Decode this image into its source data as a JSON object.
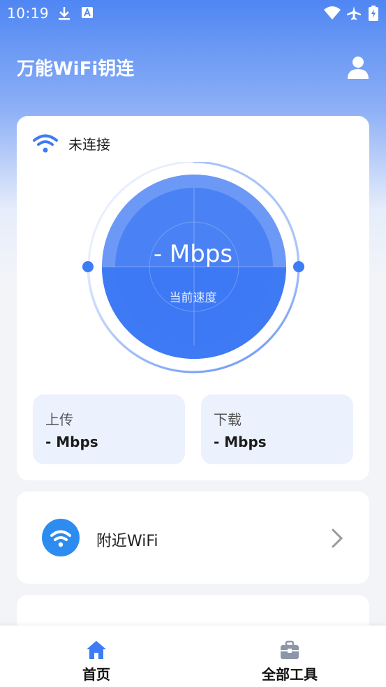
{
  "status_bar": {
    "time": "10:19",
    "icons": [
      "download-icon",
      "store-icon",
      "wifi-signal-icon",
      "airplane-mode-icon",
      "battery-charging-icon"
    ]
  },
  "header": {
    "title": "万能WiFi钥连",
    "user_icon": "user-icon"
  },
  "speed_card": {
    "connection_status": "未连接",
    "speed_value": "- Mbps",
    "speed_caption": "当前速度",
    "upload": {
      "label": "上传",
      "value": "- Mbps"
    },
    "download": {
      "label": "下载",
      "value": "- Mbps"
    }
  },
  "nearby_wifi": {
    "label": "附近WiFi",
    "icon": "wifi-icon"
  },
  "bottom_nav": {
    "items": [
      {
        "label": "首页",
        "icon": "home-icon",
        "active": true
      },
      {
        "label": "全部工具",
        "icon": "toolbox-icon",
        "active": false
      }
    ]
  },
  "colors": {
    "accent": "#3d7cf4",
    "header_gradient_top": "#4f86f3",
    "gauge_light": "#6c98f6",
    "stat_box_bg": "#ebf1fd",
    "nearby_icon_bg": "#2d8cf0"
  }
}
